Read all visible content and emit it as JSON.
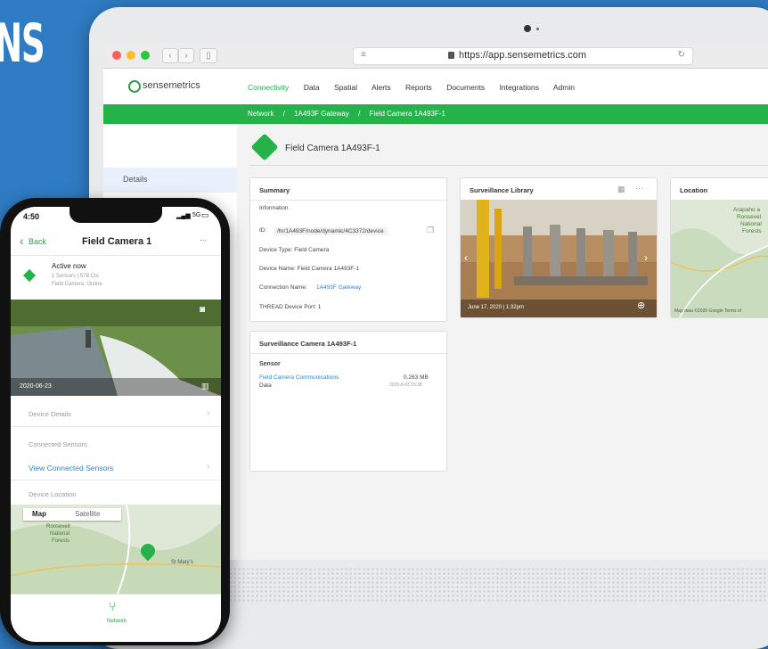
{
  "background": {
    "partial_heading": "NS"
  },
  "browser": {
    "url": "https://app.sensemetrics.com",
    "traffic_colors": [
      "#ff5f56",
      "#ffbd2e",
      "#27c93f"
    ]
  },
  "app": {
    "logo": "sensemetrics",
    "menu": [
      "Connectivity",
      "Data",
      "Spatial",
      "Alerts",
      "Reports",
      "Documents",
      "Integrations",
      "Admin"
    ],
    "active_menu": "Connectivity",
    "breadcrumbs": [
      "Network",
      "/",
      "1A493F Gateway",
      "/",
      "Field Camera 1A493F-1"
    ],
    "sidebar": {
      "details": "Details"
    },
    "device_title": "Field Camera 1A493F-1",
    "accent": "#25b24b",
    "summary": {
      "title": "Summary",
      "section": "Information",
      "id_label": "ID:",
      "id_value": "/hr/1A493F/node/dynamic/4C3372/device",
      "type": "Device Type: Field Camera",
      "name": "Device Name: Field Camera 1A493F-1",
      "conn_label": "Connection Name:",
      "conn_value": "1A493F Gateway",
      "port": "THREAD Device Port: 1"
    },
    "library": {
      "title": "Surveillance Library",
      "caption": "June 17, 2020  |  1:32pm"
    },
    "location": {
      "title": "Location",
      "map_labels": [
        "Arapaho a",
        "Roosevel",
        "National",
        "Forests"
      ],
      "footer": "Map data ©2020 Google   Terms of"
    },
    "camera_card": {
      "title": "Surveillance Camera 1A493F-1",
      "sensor": "Sensor",
      "link": "Field Camera Communications",
      "value": "0.263 MB",
      "data": "Data",
      "date": "2020-8-03 15:38"
    }
  },
  "phone": {
    "time": "4:50",
    "signal": "5G",
    "back": "Back",
    "title": "Field Camera 1",
    "more": "...",
    "status": "Active now",
    "status_sub1": "1 Sensors | 578 Cts",
    "status_sub2": "Field Camera, Online",
    "photo_date": "2020-06-23",
    "rows": [
      "Device Details",
      "Connected Sensors",
      "View Connected Sensors",
      "Device Location"
    ],
    "map_tabs": [
      "Map",
      "Satellite"
    ],
    "map_labels": [
      "Roosevelt",
      "National",
      "Forests",
      "St Mary's"
    ],
    "tab_label": "Network"
  }
}
